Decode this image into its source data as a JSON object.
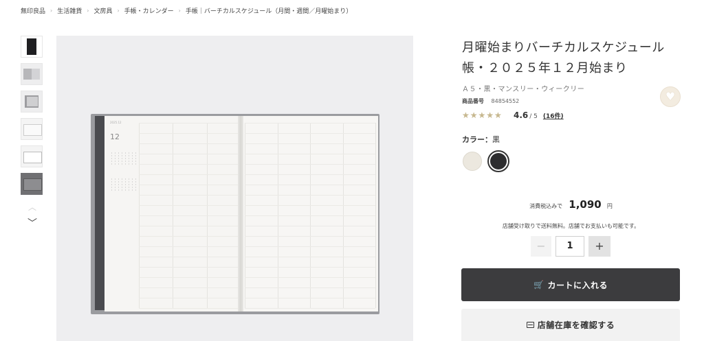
{
  "breadcrumb": [
    "無印良品",
    "生活雑貨",
    "文房具",
    "手帳・カレンダー",
    "手帳｜バーチカルスケジュール（月間・週間／月曜始まり）"
  ],
  "breadcrumb_separator": "›",
  "gallery": {
    "thumbnail_count": 6,
    "selected_index": 5,
    "up_arrow": "︿",
    "down_arrow": "﹀"
  },
  "main_image": {
    "month_text": "12",
    "header_text": "2025.12"
  },
  "product": {
    "title": "月曜始まりバーチカルスケジュール帳・２０２５年１２月始まり",
    "subtitle": "Ａ５・黒・マンスリー・ウィークリー",
    "sku_label": "商品番号",
    "sku_value": "84854552"
  },
  "favorite": {
    "icon": "♥"
  },
  "rating": {
    "stars_glyphs": "★★★★★",
    "score": 4.6,
    "value": "4.6",
    "max": "/ 5",
    "reviews": "(16件)"
  },
  "color": {
    "label": "カラー：",
    "selected": "黒",
    "options": [
      {
        "name": "white",
        "hex": "#ece8df"
      },
      {
        "name": "black",
        "hex": "#2d2d2f"
      }
    ]
  },
  "price": {
    "prefix": "消費税込みで",
    "value": "1,090",
    "unit": "円"
  },
  "shipping_note": "店舗受け取りで送料無料。店舗でお支払いも可能です。",
  "quantity": {
    "minus": "−",
    "value": "1",
    "plus": "+"
  },
  "cart_button": {
    "label": "カートに入れる",
    "icon": "🛒"
  },
  "store_button": {
    "label": "店舗在庫を確認する"
  },
  "colors": {
    "cart_bg": "#3c3c3e",
    "star_fill": "#c7b88f",
    "star_empty": "#e3dccd"
  }
}
